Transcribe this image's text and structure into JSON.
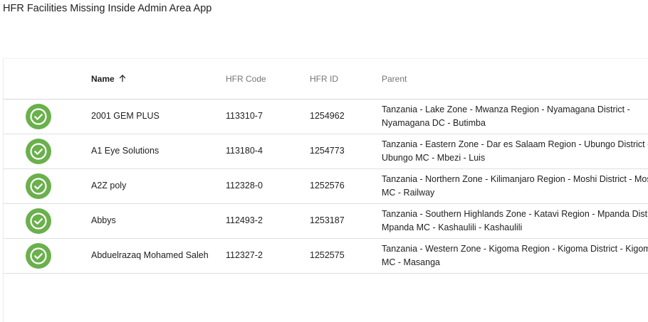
{
  "page": {
    "title": "HFR Facilities Missing Inside Admin Area App"
  },
  "table": {
    "columns": {
      "status": "",
      "name": "Name",
      "hfr_code": "HFR Code",
      "hfr_id": "HFR ID",
      "parent": "Parent"
    },
    "sort": {
      "column": "name",
      "direction": "ascending",
      "icon": "arrow-up-icon"
    },
    "status_icon": {
      "name": "check-circle-icon",
      "color": "#6ab04c"
    },
    "rows": [
      {
        "name": "2001 GEM PLUS",
        "hfr_code": "113310-7",
        "hfr_id": "1254962",
        "parent": "Tanzania - Lake Zone - Mwanza Region - Nyamagana District - Nyamagana DC - Butimba"
      },
      {
        "name": "A1 Eye Solutions",
        "hfr_code": "113180-4",
        "hfr_id": "1254773",
        "parent": "Tanzania - Eastern Zone - Dar es Salaam Region - Ubungo District - Ubungo MC - Mbezi - Luis"
      },
      {
        "name": "A2Z poly",
        "hfr_code": "112328-0",
        "hfr_id": "1252576",
        "parent": "Tanzania - Northern Zone - Kilimanjaro Region - Moshi District - Moshi MC - Railway"
      },
      {
        "name": "Abbys",
        "hfr_code": "112493-2",
        "hfr_id": "1253187",
        "parent": "Tanzania - Southern Highlands Zone - Katavi Region - Mpanda District - Mpanda MC - Kashaulili - Kashaulili"
      },
      {
        "name": "Abduelrazaq Mohamed Saleh",
        "hfr_code": "112327-2",
        "hfr_id": "1252575",
        "parent": "Tanzania - Western Zone - Kigoma Region - Kigoma District - Kigoma MC - Masanga"
      }
    ]
  }
}
